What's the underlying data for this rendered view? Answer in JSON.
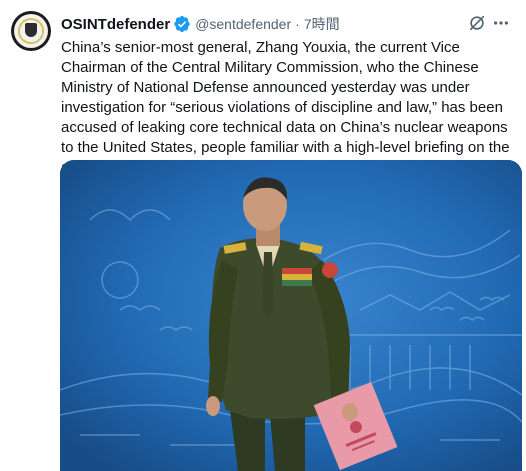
{
  "tweet": {
    "author_name": "OSINTdefender",
    "handle": "@sentdefender",
    "separator": "·",
    "time": "7時間",
    "verified_icon": "verified-badge-icon",
    "text": "China’s senior-most general, Zhang Youxia, the current Vice Chairman of the Central Military Commission, who the Chinese Ministry of National Defense announced yesterday was under investigation for “serious violations of discipline and law,” has been accused of leaking core technical data on China’s nuclear weapons to the United States, people familiar with a high-level briefing on the allegations told The Wall Street Journal."
  },
  "colors": {
    "verified": "#1d9bf0",
    "media_background": "#1f5fa3",
    "uniform": "#3d4a2c",
    "folder": "#e89aa8"
  }
}
